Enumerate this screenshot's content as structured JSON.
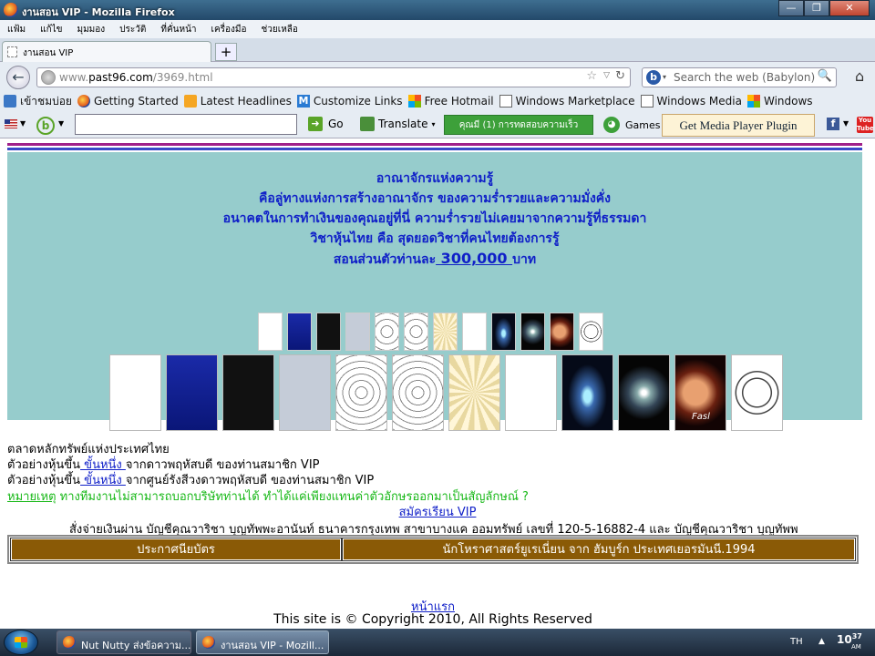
{
  "window": {
    "title": "งานสอน VIP - Mozilla Firefox",
    "min": "—",
    "max": "❐",
    "close": "✕"
  },
  "menu": [
    "แฟ้ม",
    "แก้ไข",
    "มุมมอง",
    "ประวัติ",
    "ที่คั่นหน้า",
    "เครื่องมือ",
    "ช่วยเหลือ"
  ],
  "tab": {
    "label": "งานสอน VIP",
    "new_tab": "+"
  },
  "nav": {
    "url_prefix": "www.",
    "url_domain": "past96.com",
    "url_path": "/3969.html",
    "search_placeholder": "Search the web (Babylon)",
    "back": "←",
    "star": "☆",
    "reload": "↻",
    "home": "⌂",
    "search_go": "🔍"
  },
  "bookmarks": [
    "เข้าชมบ่อย",
    "Getting Started",
    "Latest Headlines",
    "Customize Links",
    "Free Hotmail",
    "Windows Marketplace",
    "Windows Media",
    "Windows"
  ],
  "toolbar2": {
    "go": "Go",
    "translate": "Translate",
    "green_button": "คุณมี (1) การทดสอบความเร็ว",
    "games": "Games",
    "media_player": "Get Media Player Plugin",
    "youtube": "You Tube"
  },
  "page": {
    "headline_lines": [
      "อาณาจักรแห่งความรู้",
      "คือลู่ทางแห่งการสร้างอาณาจักร ของความร่ำรวยและความมั่งคั่ง",
      "อนาคตในการทำเงินของคุณอยู่ที่นี่ ความร่ำรวยไม่เคยมาจากความรู้ที่ธรรมดา",
      "วิชาหุ้นไทย คือ สุดยอดวิชาที่คนไทยต้องการรู้"
    ],
    "price_prefix": "สอนส่วนตัวท่านละ",
    "price_value": " 300,000 ",
    "price_suffix": "บาท",
    "fasl_label": "Fasl",
    "line1": "ตลาดหลักทรัพย์แห่งประเทศไทย",
    "line2_prefix": "ตัวอย่างหุ้นขึ้น",
    "line2_link": " ขั้นหนึ่ง ",
    "line2_suffix": "จากดาวพฤหัสบดี ของท่านสมาชิก VIP",
    "line3_prefix": "ตัวอย่างหุ้นขึ้น",
    "line3_link": " ขั้นหนึ่ง ",
    "line3_suffix": "จากศูนย์รังสีวงดาวพฤหัสบดี ของท่านสมาชิก VIP",
    "note_link": "หมายเหตุ",
    "note_text": " ทางทีมงานไม่สามารถบอกบริษัทท่านได้ ทำได้แค่เพียงแทนค่าตัวอักษรออกมาเป็นสัญลักษณ์ ?",
    "register_link": "สมัครเรียน VIP",
    "transfer_text": "สั่งจ่ายเงินผ่าน บัญชีคุณวาริชา บุญทัพพะอานันท์ ธนาคารกรุงเทพ สาขาบางแค ออมทรัพย์ เลขที่ 120-5-16882-4 และ บัญชีคุณวาริชา บุญทัพพ",
    "table_cells": [
      "ประกาศนียบัตร",
      "นักโหราศาสตร์ยูเรเนี่ยน จาก ฮัมบูร์ก ประเทศเยอรมันนี.1994"
    ],
    "home_link": "หน้าแรก",
    "copyright": "This site is © Copyright 2010, All Rights Reserved"
  },
  "taskbar": {
    "items": [
      "Nut Nutty ส่งข้อความ...",
      "งานสอน VIP - Mozill..."
    ],
    "lang": "TH",
    "tray_arrow": "▲",
    "time": "10",
    "time_min": "37",
    "ampm": "AM"
  }
}
